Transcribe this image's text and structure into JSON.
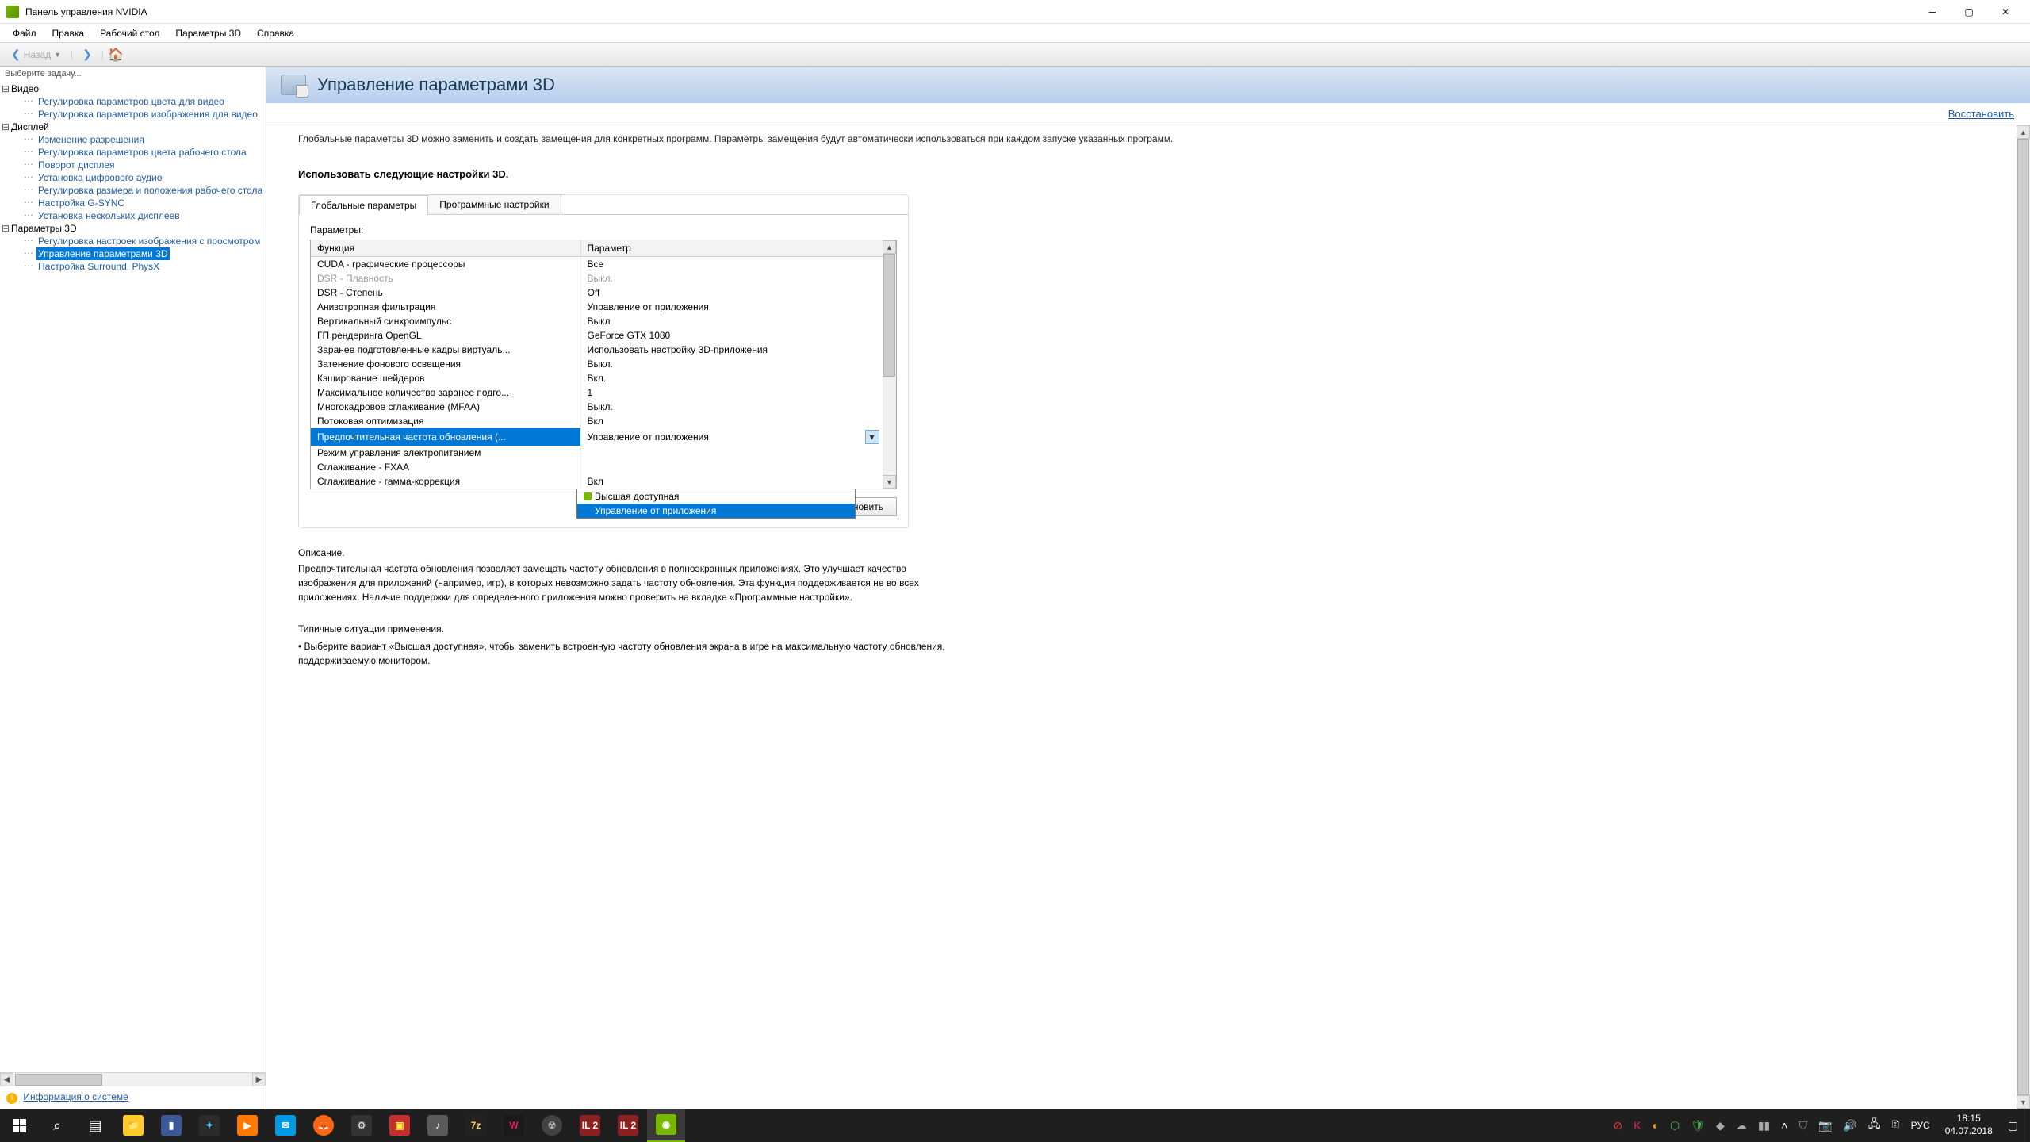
{
  "window": {
    "title": "Панель управления NVIDIA"
  },
  "menu": [
    "Файл",
    "Правка",
    "Рабочий стол",
    "Параметры 3D",
    "Справка"
  ],
  "nav": {
    "back": "Назад"
  },
  "sidebar": {
    "task_label": "Выберите задачу...",
    "groups": [
      {
        "title": "Видео",
        "items": [
          "Регулировка параметров цвета для видео",
          "Регулировка параметров изображения для видео"
        ]
      },
      {
        "title": "Дисплей",
        "items": [
          "Изменение разрешения",
          "Регулировка параметров цвета рабочего стола",
          "Поворот дисплея",
          "Установка цифрового аудио",
          "Регулировка размера и положения рабочего стола",
          "Настройка G-SYNC",
          "Установка нескольких дисплеев"
        ]
      },
      {
        "title": "Параметры 3D",
        "items": [
          "Регулировка настроек изображения с просмотром",
          "Управление параметрами 3D",
          "Настройка Surround, PhysX"
        ],
        "selected_index": 1
      }
    ],
    "sysinfo": "Информация о системе"
  },
  "header": {
    "title": "Управление параметрами 3D",
    "restore": "Восстановить"
  },
  "content": {
    "intro": "Глобальные параметры 3D можно заменить и создать замещения для конкретных программ. Параметры замещения будут автоматически использоваться при каждом запуске указанных программ.",
    "section_title": "Использовать следующие настройки 3D.",
    "tabs": [
      "Глобальные параметры",
      "Программные настройки"
    ],
    "active_tab": 0,
    "params_label": "Параметры:",
    "col_function": "Функция",
    "col_param": "Параметр",
    "rows": [
      {
        "fn": "CUDA - графические процессоры",
        "val": "Все"
      },
      {
        "fn": "DSR - Плавность",
        "val": "Выкл.",
        "disabled": true
      },
      {
        "fn": "DSR - Степень",
        "val": "Off"
      },
      {
        "fn": "Анизотропная фильтрация",
        "val": "Управление от приложения"
      },
      {
        "fn": "Вертикальный синхроимпульс",
        "val": "Выкл"
      },
      {
        "fn": "ГП рендеринга OpenGL",
        "val": "GeForce GTX 1080"
      },
      {
        "fn": "Заранее подготовленные кадры виртуаль...",
        "val": "Использовать настройку 3D-приложения"
      },
      {
        "fn": "Затенение фонового освещения",
        "val": "Выкл."
      },
      {
        "fn": "Кэширование шейдеров",
        "val": "Вкл."
      },
      {
        "fn": "Максимальное количество заранее подго...",
        "val": "1"
      },
      {
        "fn": "Многокадровое сглаживание (MFAA)",
        "val": "Выкл."
      },
      {
        "fn": "Потоковая оптимизация",
        "val": "Вкл"
      },
      {
        "fn": "Предпочтительная частота обновления (...",
        "val": "Управление от приложения",
        "selected": true,
        "combo": true
      },
      {
        "fn": "Режим управления электропитанием",
        "val": ""
      },
      {
        "fn": "Сглаживание - FXAA",
        "val": ""
      },
      {
        "fn": "Сглаживание - гамма-коррекция",
        "val": "Вкл"
      }
    ],
    "dropdown": {
      "options": [
        "Высшая доступная",
        "Управление от приложения"
      ],
      "highlighted": 1
    },
    "restore_btn": "Восстановить",
    "desc_heading": "Описание.",
    "desc_text": "Предпочтительная частота обновления позволяет замещать частоту обновления в полноэкранных приложениях. Это улучшает качество изображения для приложений (например, игр), в которых невозможно задать частоту обновления. Эта функция поддерживается не во всех приложениях. Наличие поддержки для определенного приложения можно проверить на вкладке «Программные настройки».",
    "usage_heading": "Типичные ситуации применения.",
    "usage_text": "• Выберите вариант «Высшая доступная», чтобы заменить встроенную частоту обновления экрана в игре на максимальную частоту обновления, поддерживаемую монитором."
  },
  "tray": {
    "lang": "РУС",
    "time": "18:15",
    "date": "04.07.2018"
  }
}
